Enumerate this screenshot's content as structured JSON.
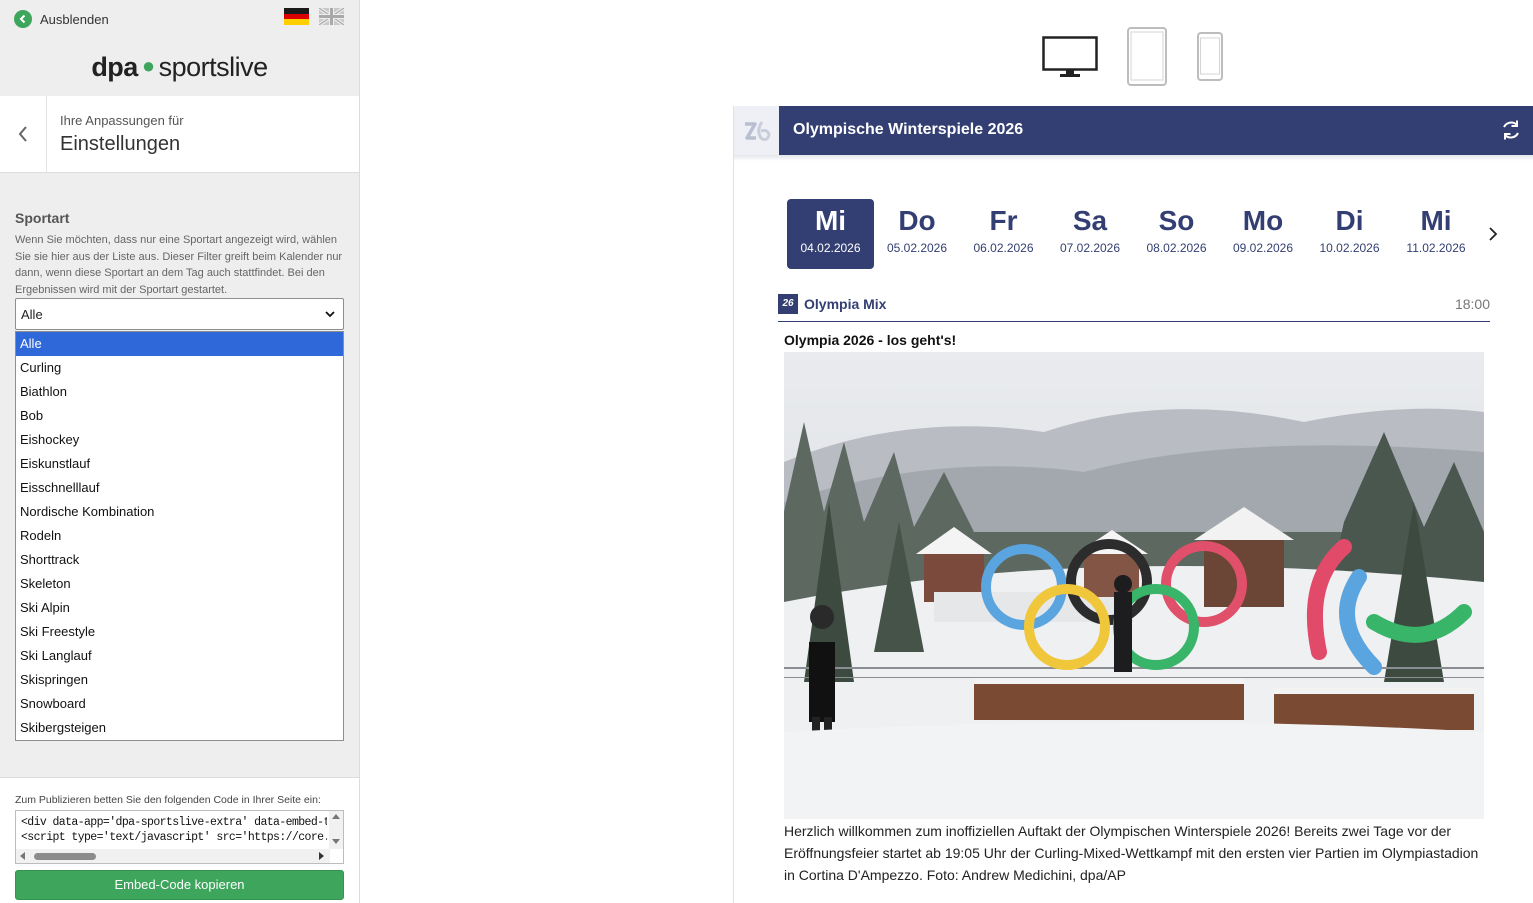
{
  "sidebar": {
    "hide_label": "Ausblenden",
    "logo": {
      "dpa": "dpa",
      "sportslive": "sportslive"
    },
    "header": {
      "subtitle": "Ihre Anpassungen für",
      "title": "Einstellungen"
    },
    "sport_section": {
      "label": "Sportart",
      "description": "Wenn Sie möchten, dass nur eine Sportart angezeigt wird, wählen Sie sie hier aus der Liste aus. Dieser Filter greift beim Kalender nur dann, wenn diese Sportart an dem Tag auch stattfindet. Bei den Ergebnissen wird mit der Sportart gestartet.",
      "selected": "Alle",
      "options": [
        "Alle",
        "Curling",
        "Biathlon",
        "Bob",
        "Eishockey",
        "Eiskunstlauf",
        "Eisschnelllauf",
        "Nordische Kombination",
        "Rodeln",
        "Shorttrack",
        "Skeleton",
        "Ski Alpin",
        "Ski Freestyle",
        "Ski Langlauf",
        "Skispringen",
        "Snowboard",
        "Skibergsteigen"
      ]
    },
    "embed": {
      "label": "Zum Publizieren betten Sie den folgenden Code in Ihrer Seite ein:",
      "code_lines": [
        "<div data-app='dpa-sportslive-extra' data-embed-type='ifra",
        "<script type='text/javascript' src='https://core.dpa-infocom"
      ],
      "copy_button": "Embed-Code kopieren"
    }
  },
  "devices": [
    "desktop-icon",
    "tablet-icon",
    "phone-icon"
  ],
  "widget": {
    "title": "Olympische Winterspiele 2026",
    "days": [
      {
        "name": "Mi",
        "date": "04.02.2026",
        "active": true
      },
      {
        "name": "Do",
        "date": "05.02.2026"
      },
      {
        "name": "Fr",
        "date": "06.02.2026"
      },
      {
        "name": "Sa",
        "date": "07.02.2026"
      },
      {
        "name": "So",
        "date": "08.02.2026"
      },
      {
        "name": "Mo",
        "date": "09.02.2026"
      },
      {
        "name": "Di",
        "date": "10.02.2026"
      },
      {
        "name": "Mi",
        "date": "11.02.2026"
      }
    ],
    "feed": {
      "icon_text": "26",
      "name": "Olympia Mix",
      "time": "18:00",
      "headline": "Olympia 2026 - los geht's!",
      "text": "Herzlich willkommen zum inoffiziellen Auftakt der Olympischen Winterspiele 2026! Bereits zwei Tage vor der Eröffnungsfeier startet ab 19:05 Uhr der Curling-Mixed-Wettkampf mit den ersten vier Partien im Olympiastadion in Cortina D'Ampezzo. Foto: Andrew Medichini, dpa/AP"
    }
  },
  "colors": {
    "brand_green": "#3ea55d",
    "widget_navy": "#333f72",
    "select_highlight": "#2f68d8"
  }
}
